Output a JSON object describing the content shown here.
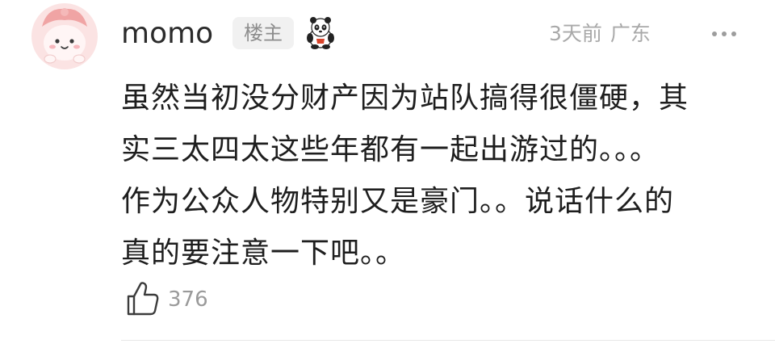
{
  "comment": {
    "username": "momo",
    "op_badge": "楼主",
    "time": "3天前",
    "location": "广东",
    "content_lines": [
      "虽然当初没分财产因为站队搞得很僵硬，其",
      "实三太四太这些年都有一起出游过的。。。",
      "作为公众人物特别又是豪门。。说话什么的",
      "真的要注意一下吧。。"
    ],
    "likes": "376",
    "sticker_icon": "panda-sticker",
    "avatar_icon": "cartoon-bunny-avatar",
    "more_icon": "more-dots-icon",
    "like_icon": "thumbs-up-icon"
  }
}
